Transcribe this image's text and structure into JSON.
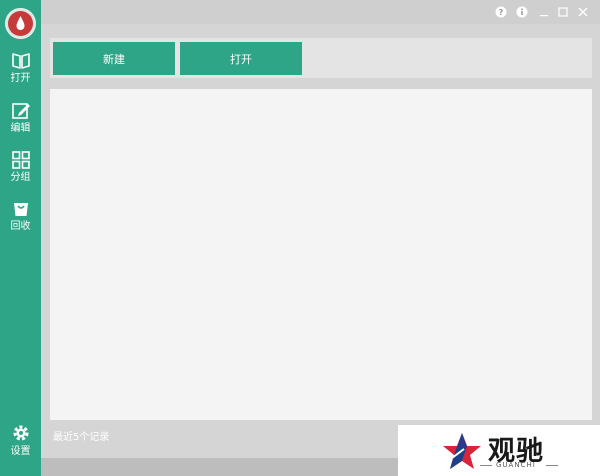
{
  "sidebar": {
    "items": [
      {
        "label": "打开",
        "icon": "book-open-icon"
      },
      {
        "label": "编辑",
        "icon": "edit-icon"
      },
      {
        "label": "分组",
        "icon": "grid-icon"
      },
      {
        "label": "回收",
        "icon": "trash-bag-icon"
      }
    ],
    "settings": {
      "label": "设置",
      "icon": "gear-icon"
    }
  },
  "toolbar": {
    "new_label": "新建",
    "open_label": "打开"
  },
  "status": {
    "recent_text": "最近5个记录"
  },
  "watermark": {
    "brand": "观驰",
    "sub": "GUANCHI"
  },
  "colors": {
    "accent": "#2ea586",
    "logo_red": "#c63a3a",
    "background": "#d5d5d5",
    "content": "#f4f4f4"
  }
}
